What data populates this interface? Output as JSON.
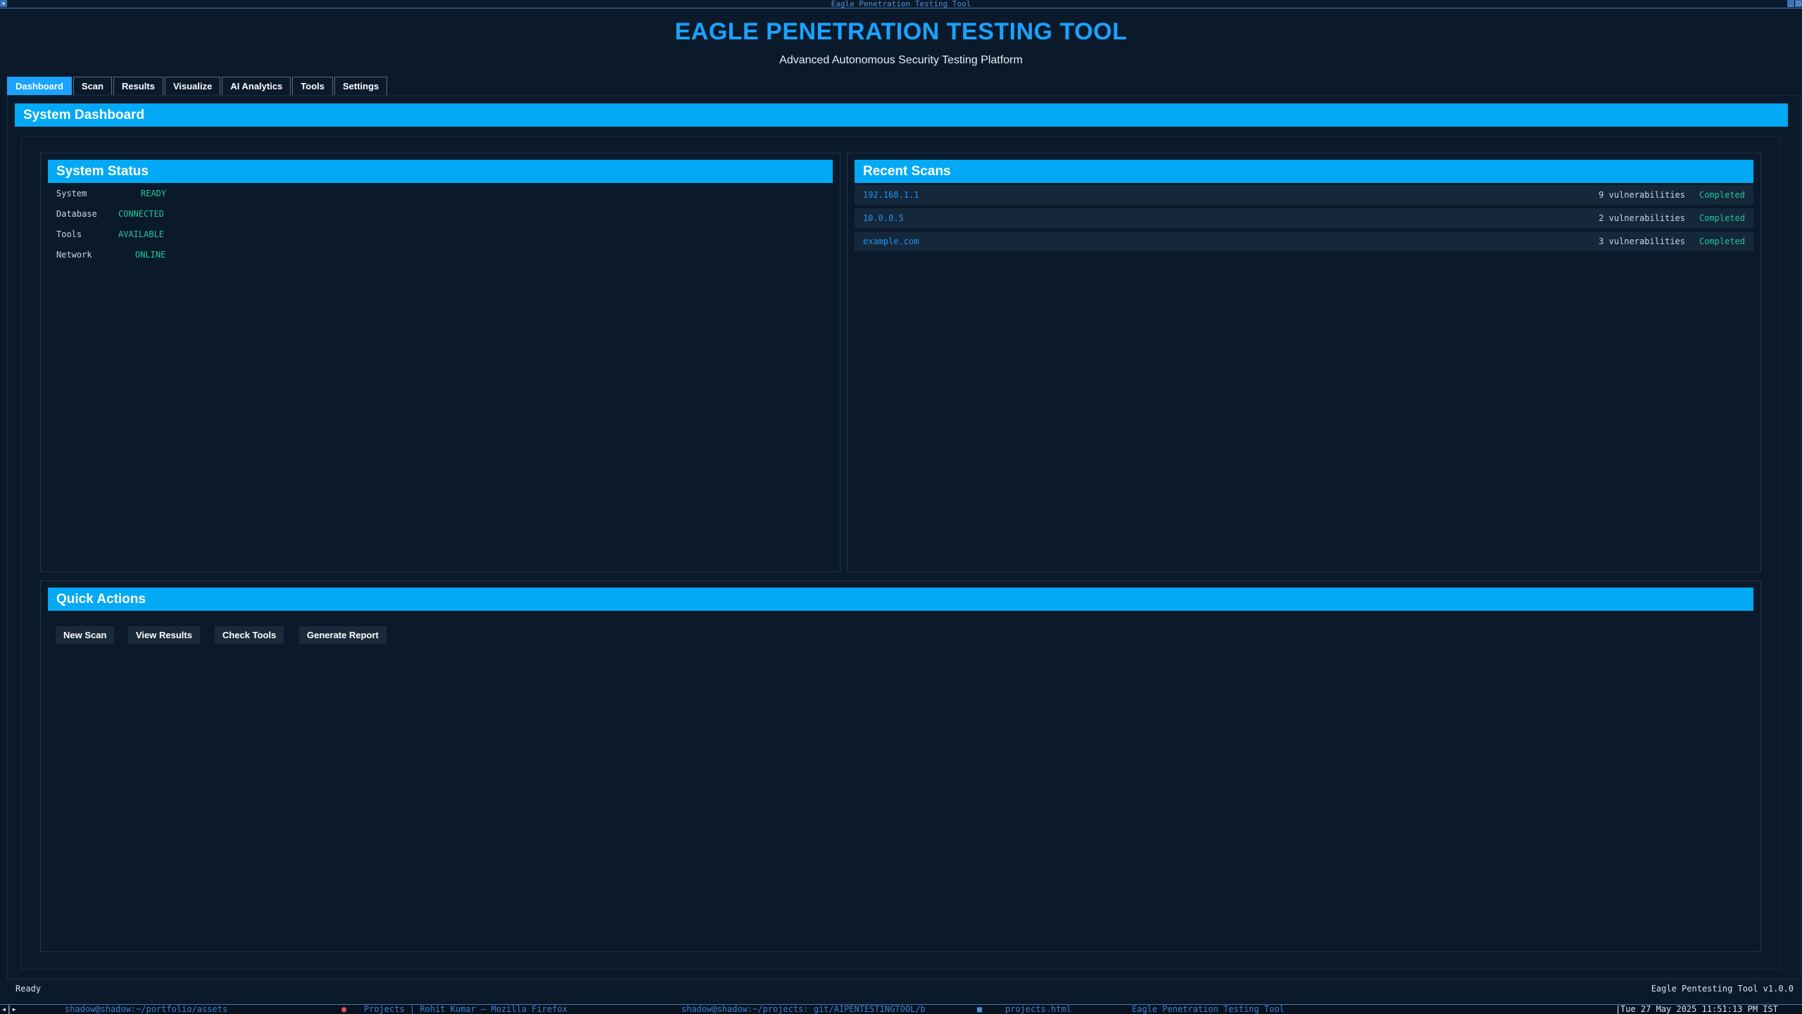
{
  "window": {
    "title": "Eagle Penetration Testing Tool"
  },
  "header": {
    "title": "EAGLE PENETRATION TESTING TOOL",
    "subtitle": "Advanced Autonomous Security Testing Platform"
  },
  "tabs": [
    {
      "label": "Dashboard",
      "active": true
    },
    {
      "label": "Scan",
      "active": false
    },
    {
      "label": "Results",
      "active": false
    },
    {
      "label": "Visualize",
      "active": false
    },
    {
      "label": "AI Analytics",
      "active": false
    },
    {
      "label": "Tools",
      "active": false
    },
    {
      "label": "Settings",
      "active": false
    }
  ],
  "dashboard": {
    "title": "System Dashboard"
  },
  "system_status": {
    "title": "System Status",
    "rows": [
      {
        "label": "System",
        "value": "READY"
      },
      {
        "label": "Database",
        "value": "CONNECTED"
      },
      {
        "label": "Tools",
        "value": "AVAILABLE"
      },
      {
        "label": "Network",
        "value": "ONLINE"
      }
    ]
  },
  "recent_scans": {
    "title": "Recent Scans",
    "rows": [
      {
        "target": "192.168.1.1",
        "vulns": "9 vulnerabilities",
        "status": "Completed"
      },
      {
        "target": "10.0.0.5",
        "vulns": "2 vulnerabilities",
        "status": "Completed"
      },
      {
        "target": "example.com",
        "vulns": "3 vulnerabilities",
        "status": "Completed"
      }
    ]
  },
  "quick_actions": {
    "title": "Quick Actions",
    "buttons": [
      "New Scan",
      "View Results",
      "Check Tools",
      "Generate Report"
    ]
  },
  "statusbar": {
    "status": "Ready",
    "version": "Eagle Pentesting Tool v1.0.0"
  },
  "taskbar": {
    "items": [
      "shadow@shadow:~/portfolio/assets",
      "Projects | Rohit Kumar — Mozilla Firefox",
      "shadow@shadow:~/projects: git/AIPENTESTINGTOOL/b",
      "projects.html",
      "Eagle Penetration Testing Tool"
    ],
    "clock": "Tue 27 May 2025 11:51:13 PM IST"
  },
  "colors": {
    "background": "#0b1a2b",
    "accent": "#03a9f4",
    "title": "#1aa3ff",
    "ok_status": "#21c79a",
    "link": "#2196f3"
  }
}
